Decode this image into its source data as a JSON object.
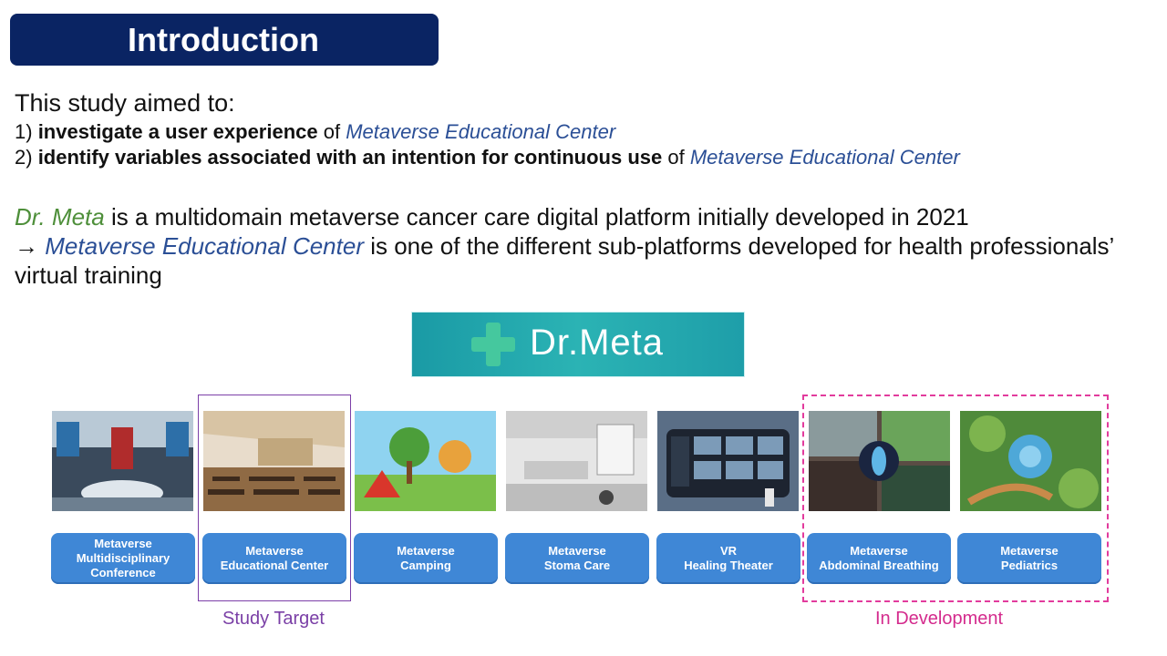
{
  "title": "Introduction",
  "intro": {
    "lead": "This study aimed to:",
    "item1_num": "1) ",
    "item1_bold": "investigate a user experience",
    "item1_mid": " of ",
    "item1_italic": "Metaverse Educational  Center",
    "item2_num": "2) ",
    "item2_bold": "identify variables associated with an intention for continuous use",
    "item2_mid": " of ",
    "item2_italic": "Metaverse Educational  Center"
  },
  "description": {
    "brand": "Dr. Meta",
    "line1_rest": " is a multidomain metaverse cancer care digital platform initially developed in 2021",
    "arrow": "→ ",
    "sub_platform": "Metaverse Educational Center",
    "line2_rest": " is one of the different sub-platforms developed for health professionals’ virtual training"
  },
  "logo": {
    "text": "Dr.Meta",
    "icon": "medical-cross-icon"
  },
  "platforms": [
    {
      "label": "Metaverse\nMultidisciplinary\nConference"
    },
    {
      "label": "Metaverse\nEducational Center"
    },
    {
      "label": "Metaverse\nCamping"
    },
    {
      "label": "Metaverse\nStoma Care"
    },
    {
      "label": "VR\nHealing Theater"
    },
    {
      "label": "Metaverse\nAbdominal Breathing"
    },
    {
      "label": "Metaverse\nPediatrics"
    }
  ],
  "labels": {
    "study_target": "Study Target",
    "in_development": "In Development"
  },
  "colors": {
    "title_bg": "#0a2463",
    "accent_blue": "#2b4f96",
    "brand_green": "#4e8f3a",
    "button_blue": "#3f87d6",
    "study_purple": "#7c3fa8",
    "dev_pink": "#e23b9d"
  }
}
